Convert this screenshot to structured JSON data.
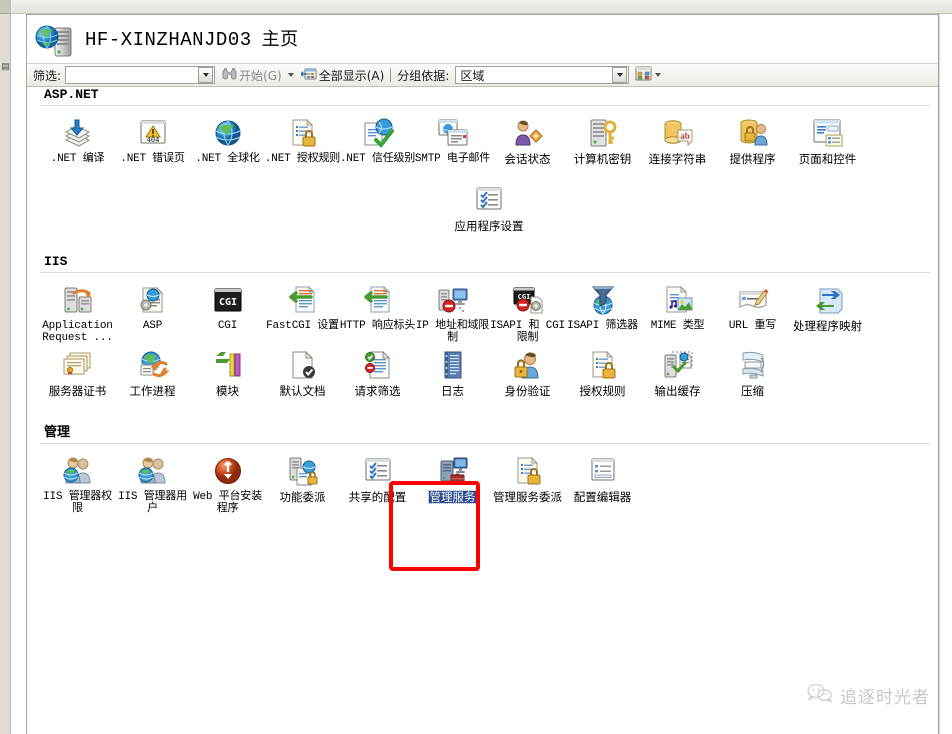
{
  "window": {
    "title_server": "HF-XINZHANJD03",
    "title_page": "主页"
  },
  "toolbar": {
    "filter_label": "筛选:",
    "filter_value": "",
    "filter_placeholder": "",
    "start_label": "开始(G)",
    "start_icon": "binoculars-icon",
    "show_all_label": "全部显示(A)",
    "show_all_icon": "show-all-icon",
    "group_by_label": "分组依据:",
    "group_by_value": "区域",
    "view_icon": "view-mode-icon",
    "dropdown_icon": "chevron-down-icon"
  },
  "sections": [
    {
      "id": "aspnet",
      "title": "ASP.NET",
      "title_style": "mono",
      "items": [
        {
          "label": "NET 编译",
          "label_prefix": ".NET",
          "label_text": ".NET 编译",
          "icon": "net-compilation-icon",
          "mono": true,
          "selected": false
        },
        {
          "label": ".NET 错误页",
          "label_text": ".NET 错误页",
          "icon": "net-error-pages-icon",
          "mono": true,
          "selected": false
        },
        {
          "label": ".NET 全球化",
          "label_text": ".NET 全球化",
          "icon": "net-globalization-icon",
          "mono": true,
          "selected": false
        },
        {
          "label": ".NET 授权规则",
          "label_text": ".NET 授权规则",
          "icon": "net-authorization-rules-icon",
          "mono": true,
          "selected": false
        },
        {
          "label": ".NET 信任级别",
          "label_text": ".NET 信任级别",
          "icon": "net-trust-levels-icon",
          "mono": true,
          "selected": false
        },
        {
          "label": "SMTP 电子邮件",
          "label_text": "SMTP 电子邮件",
          "icon": "smtp-email-icon",
          "mono": true,
          "selected": false
        },
        {
          "label": "会话状态",
          "label_text": "会话状态",
          "icon": "session-state-icon",
          "mono": false,
          "selected": false
        },
        {
          "label": "计算机密钥",
          "label_text": "计算机密钥",
          "icon": "machine-key-icon",
          "mono": false,
          "selected": false
        },
        {
          "label": "连接字符串",
          "label_text": "连接字符串",
          "icon": "connection-strings-icon",
          "mono": false,
          "selected": false
        },
        {
          "label": "提供程序",
          "label_text": "提供程序",
          "icon": "providers-icon",
          "mono": false,
          "selected": false
        },
        {
          "label": "页面和控件",
          "label_text": "页面和控件",
          "icon": "pages-and-controls-icon",
          "mono": false,
          "selected": false
        },
        {
          "label": "应用程序设置",
          "label_text": "应用程序设置",
          "icon": "application-settings-icon",
          "mono": false,
          "selected": false
        }
      ]
    },
    {
      "id": "iis",
      "title": "IIS",
      "title_style": "mono",
      "items": [
        {
          "label": "Application Request ...",
          "label_text": "Application Request ...",
          "icon": "application-request-routing-icon",
          "mono": true,
          "selected": false
        },
        {
          "label": "ASP",
          "label_text": "ASP",
          "icon": "asp-icon",
          "mono": true,
          "selected": false
        },
        {
          "label": "CGI",
          "label_text": "CGI",
          "icon": "cgi-icon",
          "mono": true,
          "selected": false
        },
        {
          "label": "FastCGI 设置",
          "label_text": "FastCGI 设置",
          "icon": "fastcgi-settings-icon",
          "mono": true,
          "selected": false
        },
        {
          "label": "HTTP 响应标头",
          "label_text": "HTTP 响应标头",
          "icon": "http-response-headers-icon",
          "mono": true,
          "selected": false
        },
        {
          "label": "IP 地址和域限制",
          "label_text": "IP 地址和域限制",
          "icon": "ip-address-domain-restrictions-icon",
          "mono": true,
          "selected": false
        },
        {
          "label": "ISAPI 和 CGI 限制",
          "label_text": "ISAPI 和 CGI 限制",
          "icon": "isapi-cgi-restrictions-icon",
          "mono": true,
          "selected": false
        },
        {
          "label": "ISAPI 筛选器",
          "label_text": "ISAPI 筛选器",
          "icon": "isapi-filters-icon",
          "mono": true,
          "selected": false
        },
        {
          "label": "MIME 类型",
          "label_text": "MIME 类型",
          "icon": "mime-types-icon",
          "mono": true,
          "selected": false
        },
        {
          "label": "URL 重写",
          "label_text": "URL 重写",
          "icon": "url-rewrite-icon",
          "mono": true,
          "selected": false
        },
        {
          "label": "处理程序映射",
          "label_text": "处理程序映射",
          "icon": "handler-mappings-icon",
          "mono": false,
          "selected": false
        },
        {
          "label": "服务器证书",
          "label_text": "服务器证书",
          "icon": "server-certificates-icon",
          "mono": false,
          "selected": false
        },
        {
          "label": "工作进程",
          "label_text": "工作进程",
          "icon": "worker-processes-icon",
          "mono": false,
          "selected": false
        },
        {
          "label": "模块",
          "label_text": "模块",
          "icon": "modules-icon",
          "mono": false,
          "selected": false
        },
        {
          "label": "默认文档",
          "label_text": "默认文档",
          "icon": "default-document-icon",
          "mono": false,
          "selected": false
        },
        {
          "label": "请求筛选",
          "label_text": "请求筛选",
          "icon": "request-filtering-icon",
          "mono": false,
          "selected": false
        },
        {
          "label": "日志",
          "label_text": "日志",
          "icon": "logging-icon",
          "mono": false,
          "selected": false
        },
        {
          "label": "身份验证",
          "label_text": "身份验证",
          "icon": "authentication-icon",
          "mono": false,
          "selected": false
        },
        {
          "label": "授权规则",
          "label_text": "授权规则",
          "icon": "authorization-rules-icon",
          "mono": false,
          "selected": false
        },
        {
          "label": "输出缓存",
          "label_text": "输出缓存",
          "icon": "output-caching-icon",
          "mono": false,
          "selected": false
        },
        {
          "label": "压缩",
          "label_text": "压缩",
          "icon": "compression-icon",
          "mono": false,
          "selected": false
        }
      ]
    },
    {
      "id": "management",
      "title": "管理",
      "title_style": "cn",
      "items": [
        {
          "label": "IIS 管理器权限",
          "label_text": "IIS 管理器权限",
          "icon": "iis-manager-permissions-icon",
          "mono": true,
          "selected": false
        },
        {
          "label": "IIS 管理器用户",
          "label_text": "IIS 管理器用户",
          "icon": "iis-manager-users-icon",
          "mono": true,
          "selected": false
        },
        {
          "label": "Web 平台安装程序",
          "label_text": "Web 平台安装程序",
          "icon": "web-platform-installer-icon",
          "mono": true,
          "selected": false
        },
        {
          "label": "功能委派",
          "label_text": "功能委派",
          "icon": "feature-delegation-icon",
          "mono": false,
          "selected": false
        },
        {
          "label": "共享的配置",
          "label_text": "共享的配置",
          "icon": "shared-configuration-icon",
          "mono": false,
          "selected": false
        },
        {
          "label": "管理服务",
          "label_text": "管理服务",
          "icon": "management-service-icon",
          "mono": false,
          "selected": true
        },
        {
          "label": "管理服务委派",
          "label_text": "管理服务委派",
          "icon": "management-service-delegation-icon",
          "mono": false,
          "selected": false
        },
        {
          "label": "配置编辑器",
          "label_text": "配置编辑器",
          "icon": "configuration-editor-icon",
          "mono": false,
          "selected": false
        }
      ]
    }
  ],
  "annotation": {
    "target_label": "管理服务",
    "box_color": "#ff0000"
  },
  "watermark": {
    "text": "追逐时光者",
    "icon": "wechat-icon"
  }
}
